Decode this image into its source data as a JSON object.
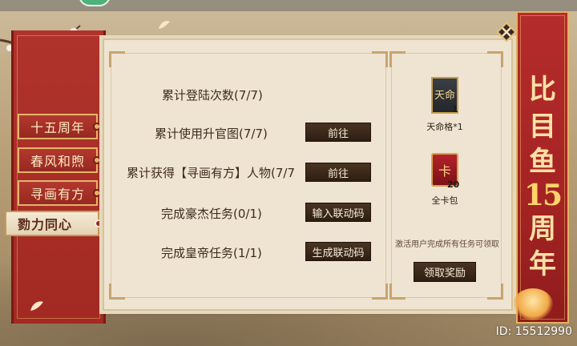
{
  "tabs": [
    {
      "label": "十五周年",
      "active": false
    },
    {
      "label": "春风和煦",
      "active": false
    },
    {
      "label": "寻画有方",
      "active": false
    },
    {
      "label": "勠力同心",
      "active": true
    }
  ],
  "tasks": [
    {
      "label": "累计登陆次数(7/7)",
      "button": ""
    },
    {
      "label": "累计使用升官图(7/7)",
      "button": "前往"
    },
    {
      "label": "累计获得【寻画有方】人物(7/7",
      "button": "前往"
    },
    {
      "label": "完成豪杰任务(0/1)",
      "button": "输入联动码"
    },
    {
      "label": "完成皇帝任务(1/1)",
      "button": "生成联动码"
    }
  ],
  "rewards": [
    {
      "icon": "tianming-card-icon",
      "glyph": "天命",
      "count": "1",
      "name": "天命格*1"
    },
    {
      "icon": "card-pack-icon",
      "glyph": "卡",
      "count": "20",
      "name": "全卡包"
    }
  ],
  "reward_hint": "激活用户完成所有任务可领取",
  "claim_label": "领取奖励",
  "banner": [
    "比",
    "目",
    "鱼",
    "15",
    "周",
    "年"
  ],
  "footer_id": "ID: 15512990",
  "colors": {
    "scroll_red": "#a22a23",
    "gold_trim": "#e3b56a",
    "paper": "#eee4d1",
    "button_dark": "#2e1e13"
  }
}
